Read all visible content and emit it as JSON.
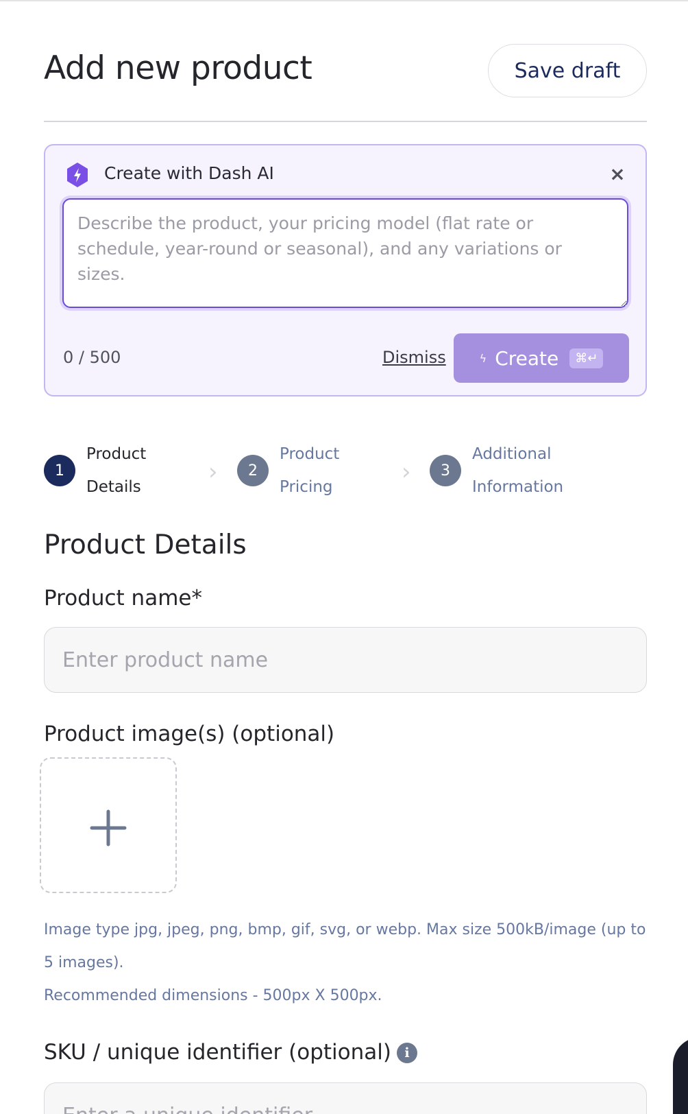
{
  "header": {
    "title": "Add new product",
    "save_draft_label": "Save draft"
  },
  "ai_panel": {
    "logo_icon": "dash-ai-bolt-hexagon-icon",
    "title": "Create with Dash AI",
    "close_icon": "×",
    "prompt_placeholder": "Describe the product, your pricing model (flat rate or schedule, year-round or seasonal), and any variations or sizes.",
    "prompt_value": "",
    "char_count": "0 / 500",
    "dismiss_label": "Dismiss",
    "create_icon": "ϟ",
    "create_label": "Create",
    "create_shortcut": "⌘↵",
    "accent_color": "#6a4bd6",
    "create_button_color": "#a590df"
  },
  "stepper": {
    "steps": [
      {
        "number": "1",
        "label": "Product Details",
        "state": "active",
        "color": "#1c2b5e"
      },
      {
        "number": "2",
        "label": "Product Pricing",
        "state": "upcoming",
        "color": "#6b788f"
      },
      {
        "number": "3",
        "label": "Additional Information",
        "state": "upcoming",
        "color": "#6b788f"
      }
    ],
    "separator": "›"
  },
  "product_details": {
    "section_title": "Product Details",
    "name_label": "Product name*",
    "name_placeholder": "Enter product name",
    "name_value": "",
    "images_label": "Product image(s) (optional)",
    "upload_icon": "plus-icon",
    "image_help_line1": "Image type jpg, jpeg, png, bmp, gif, svg, or webp. Max size 500kB/image (up to 5 images).",
    "image_help_line2": "Recommended dimensions - 500px X 500px.",
    "sku_label": "SKU / unique identifier (optional)",
    "sku_info_icon": "i",
    "sku_placeholder": "Enter a unique identifier",
    "sku_value": ""
  }
}
